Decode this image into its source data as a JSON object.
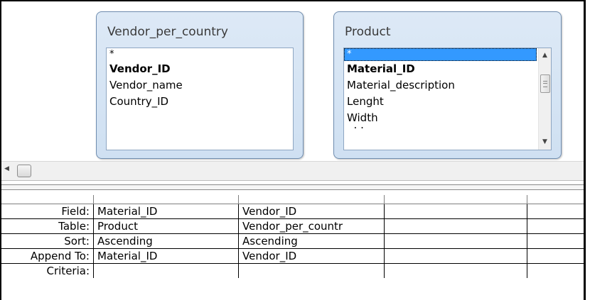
{
  "tables": [
    {
      "title": "Vendor_per_country",
      "fields": [
        {
          "label": "*",
          "bold": false,
          "selected": false
        },
        {
          "label": "Vendor_ID",
          "bold": true,
          "selected": false
        },
        {
          "label": "Vendor_name",
          "bold": false,
          "selected": false
        },
        {
          "label": "Country_ID",
          "bold": false,
          "selected": false
        }
      ]
    },
    {
      "title": "Product",
      "fields": [
        {
          "label": "*",
          "bold": false,
          "selected": true
        },
        {
          "label": "Material_ID",
          "bold": true,
          "selected": false
        },
        {
          "label": "Material_description",
          "bold": false,
          "selected": false
        },
        {
          "label": "Lenght",
          "bold": false,
          "selected": false
        },
        {
          "label": "Width",
          "bold": false,
          "selected": false
        }
      ]
    }
  ],
  "grid": {
    "row_labels": [
      "Field:",
      "Table:",
      "Sort:",
      "Append To:",
      "Criteria:"
    ],
    "columns": [
      {
        "field": "Material_ID",
        "table": "Product",
        "sort": "Ascending",
        "append_to": "Material_ID",
        "criteria": ""
      },
      {
        "field": "Vendor_ID",
        "table": "Vendor_per_countr",
        "sort": "Ascending",
        "append_to": "Vendor_ID",
        "criteria": ""
      },
      {
        "field": "",
        "table": "",
        "sort": "",
        "append_to": "",
        "criteria": ""
      },
      {
        "field": "",
        "table": "",
        "sort": "",
        "append_to": "",
        "criteria": ""
      }
    ]
  },
  "icons": {
    "scroll_up": "scroll-up-arrow-icon",
    "scroll_down": "scroll-down-arrow-icon",
    "scroll_left": "scroll-left-arrow-icon"
  },
  "colors": {
    "selection": "#3399ff",
    "table_box": "#d6e5f5",
    "table_border": "#6f8db0"
  }
}
